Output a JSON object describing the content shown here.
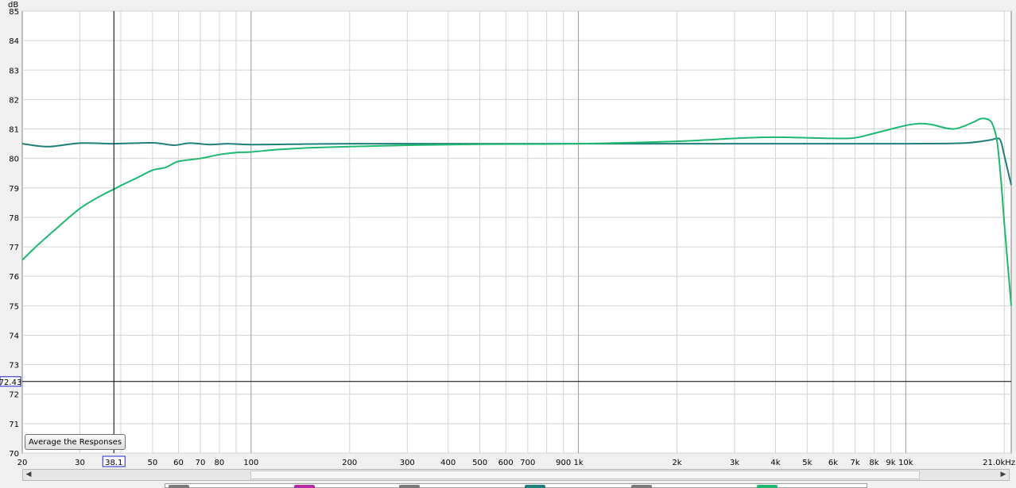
{
  "chart_data": {
    "type": "line",
    "ylabel": "dB",
    "xscale": "log",
    "xlim": [
      20,
      21000
    ],
    "ylim": [
      70,
      85
    ],
    "y_ticks": [
      70,
      71,
      72,
      73,
      74,
      75,
      76,
      77,
      78,
      79,
      80,
      81,
      82,
      83,
      84,
      85
    ],
    "x_ticks": [
      {
        "v": 20,
        "label": "20"
      },
      {
        "v": 30,
        "label": "30"
      },
      {
        "v": 40,
        "label": ""
      },
      {
        "v": 50,
        "label": "50"
      },
      {
        "v": 60,
        "label": "60"
      },
      {
        "v": 70,
        "label": "70"
      },
      {
        "v": 80,
        "label": "80"
      },
      {
        "v": 90,
        "label": ""
      },
      {
        "v": 100,
        "label": "100"
      },
      {
        "v": 200,
        "label": "200"
      },
      {
        "v": 300,
        "label": "300"
      },
      {
        "v": 400,
        "label": "400"
      },
      {
        "v": 500,
        "label": "500"
      },
      {
        "v": 600,
        "label": "600"
      },
      {
        "v": 700,
        "label": "700"
      },
      {
        "v": 800,
        "label": ""
      },
      {
        "v": 900,
        "label": "900"
      },
      {
        "v": 1000,
        "label": "1k"
      },
      {
        "v": 2000,
        "label": "2k"
      },
      {
        "v": 3000,
        "label": "3k"
      },
      {
        "v": 4000,
        "label": "4k"
      },
      {
        "v": 5000,
        "label": "5k"
      },
      {
        "v": 6000,
        "label": "6k"
      },
      {
        "v": 7000,
        "label": "7k"
      },
      {
        "v": 8000,
        "label": "8k"
      },
      {
        "v": 9000,
        "label": "9k"
      },
      {
        "v": 10000,
        "label": "10k"
      },
      {
        "v": 20000,
        "label": ""
      },
      {
        "v": 21000,
        "label": "21.0kHz"
      }
    ],
    "major_x": [
      100,
      1000,
      10000
    ],
    "grid": true,
    "cursor": {
      "x": 38.1,
      "y": 72.43,
      "x_label": "38.1",
      "y_label": "72.43"
    },
    "series": [
      {
        "color": "#1f7f78",
        "x": [
          20,
          24,
          30,
          38,
          50,
          58,
          65,
          75,
          85,
          100,
          150,
          200,
          500,
          1000,
          2000,
          5000,
          10000,
          15000,
          18000,
          19000,
          19500,
          20000,
          21000
        ],
        "y": [
          80.5,
          80.4,
          80.52,
          80.5,
          80.53,
          80.45,
          80.52,
          80.47,
          80.5,
          80.47,
          80.49,
          80.5,
          80.5,
          80.5,
          80.5,
          80.5,
          80.5,
          80.52,
          80.62,
          80.68,
          80.6,
          80.1,
          79.1
        ]
      },
      {
        "color": "#1fb870",
        "x": [
          20,
          22,
          25,
          30,
          35,
          38,
          40,
          45,
          50,
          55,
          60,
          70,
          80,
          90,
          100,
          120,
          150,
          200,
          300,
          500,
          1000,
          2000,
          3000,
          4000,
          6000,
          7000,
          8000,
          10000,
          11000,
          12000,
          14000,
          16000,
          17000,
          18000,
          18500,
          19000,
          19500,
          20000,
          21000
        ],
        "y": [
          76.55,
          77.0,
          77.55,
          78.3,
          78.75,
          78.95,
          79.08,
          79.35,
          79.6,
          79.7,
          79.9,
          80.0,
          80.13,
          80.2,
          80.22,
          80.3,
          80.36,
          80.4,
          80.45,
          80.48,
          80.5,
          80.58,
          80.68,
          80.72,
          80.68,
          80.7,
          80.85,
          81.12,
          81.18,
          81.15,
          81.0,
          81.22,
          81.35,
          81.3,
          81.1,
          80.6,
          79.4,
          77.8,
          75.0
        ]
      }
    ]
  },
  "ui": {
    "average_button": "Average the Responses",
    "scroll_left": "◀",
    "scroll_right": "▶",
    "legend_colors": [
      "#7a7a7a",
      "#b32aa6",
      "#7a7a7a",
      "#1f7f78",
      "#7a7a7a",
      "#1fb870"
    ]
  }
}
